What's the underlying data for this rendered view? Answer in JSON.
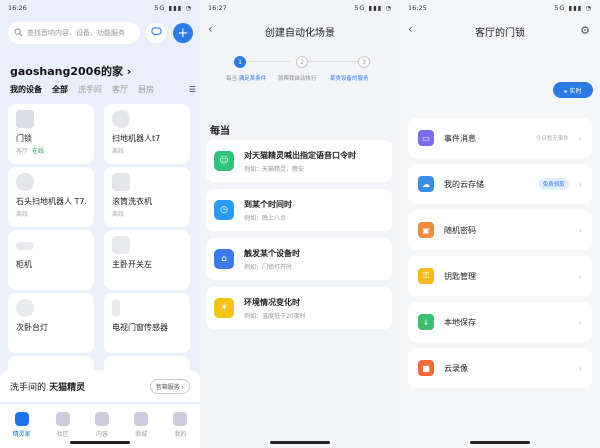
{
  "panel1": {
    "status_time": "16:26",
    "status_icons": "5G ▮▮▮ ◔",
    "search_placeholder": "查找音响内容、设备、功能服务",
    "home_name": "gaoshang2006的家 ›",
    "tabs": [
      "我的设备",
      "全部",
      "洗手间",
      "客厅",
      "厨房"
    ],
    "devices": [
      {
        "name": "门锁",
        "room": "客厅",
        "status": "在线",
        "color": "#d9dde5"
      },
      {
        "name": "扫地机器人t7",
        "room": "离线",
        "status": "",
        "color": "#e4e6ea"
      },
      {
        "name": "石头扫地机器人 T7...",
        "room": "离线",
        "status": "",
        "color": "#e4e6ea"
      },
      {
        "name": "滚筒洗衣机",
        "room": "离线",
        "status": "",
        "color": "#e4e6ea"
      },
      {
        "name": "柜机",
        "room": "",
        "status": "",
        "color": "#e8eaee"
      },
      {
        "name": "主卧开关左",
        "room": "",
        "status": "",
        "color": "#e8eaee"
      },
      {
        "name": "次卧台灯",
        "room": "",
        "status": "",
        "color": "#e8eaee"
      },
      {
        "name": "电视门窗传感器",
        "room": "",
        "status": "",
        "color": "#e8eaee"
      }
    ],
    "voice": {
      "text_pre": "洗手间的",
      "text_bold": " 天猫精灵",
      "button": "音箱服务 ›"
    },
    "nav": [
      "精灵家",
      "社区",
      "内容",
      "商城",
      "我的"
    ]
  },
  "panel2": {
    "status_time": "16:27",
    "status_icons": "5G ▮▮▮ ◔",
    "title": "创建自动化场景",
    "steps": [
      {
        "num": "1",
        "label_pre": "每当",
        "label_blue": "满足某条件"
      },
      {
        "num": "2",
        "label_pre": "就帮我自动执行",
        "label_blue": ""
      },
      {
        "num": "3",
        "label_pre": "",
        "label_blue": "某类设备的服务"
      }
    ],
    "section": "每当",
    "cards": [
      {
        "title": "对天猫精灵喊出指定语音口令时",
        "sub": "例如：天猫精灵，晚安",
        "color": "#2fc27a",
        "icon": "☺"
      },
      {
        "title": "到某个时间时",
        "sub": "例如：晚上八点",
        "color": "#2b9bf0",
        "icon": "◷"
      },
      {
        "title": "触发某个设备时",
        "sub": "例如：门锁打开时",
        "color": "#3a7be8",
        "icon": "⌂"
      },
      {
        "title": "环境情况变化时",
        "sub": "例如：温度低于20度时",
        "color": "#f5c218",
        "icon": "☀"
      }
    ]
  },
  "panel3": {
    "status_time": "16:25",
    "status_icons": "5G ▮▮▮ ◔",
    "title": "客厅的门锁",
    "live_button": "▸ 实时",
    "rows": [
      {
        "label": "事件消息",
        "extra": "今日暂无事件",
        "badge": "",
        "color": "#7c6bf0",
        "icon": "▭"
      },
      {
        "label": "我的云存储",
        "extra": "",
        "badge": "免费领取",
        "color": "#3a8ee6",
        "icon": "☁"
      },
      {
        "label": "随机密码",
        "extra": "",
        "badge": "",
        "color": "#f08a3c",
        "icon": "▣"
      },
      {
        "label": "钥匙管理",
        "extra": "",
        "badge": "",
        "color": "#f5b820",
        "icon": "⚿"
      },
      {
        "label": "本地保存",
        "extra": "",
        "badge": "",
        "color": "#3cbf6a",
        "icon": "↓"
      },
      {
        "label": "云录像",
        "extra": "",
        "badge": "",
        "color": "#f06a3c",
        "icon": "■"
      }
    ]
  }
}
